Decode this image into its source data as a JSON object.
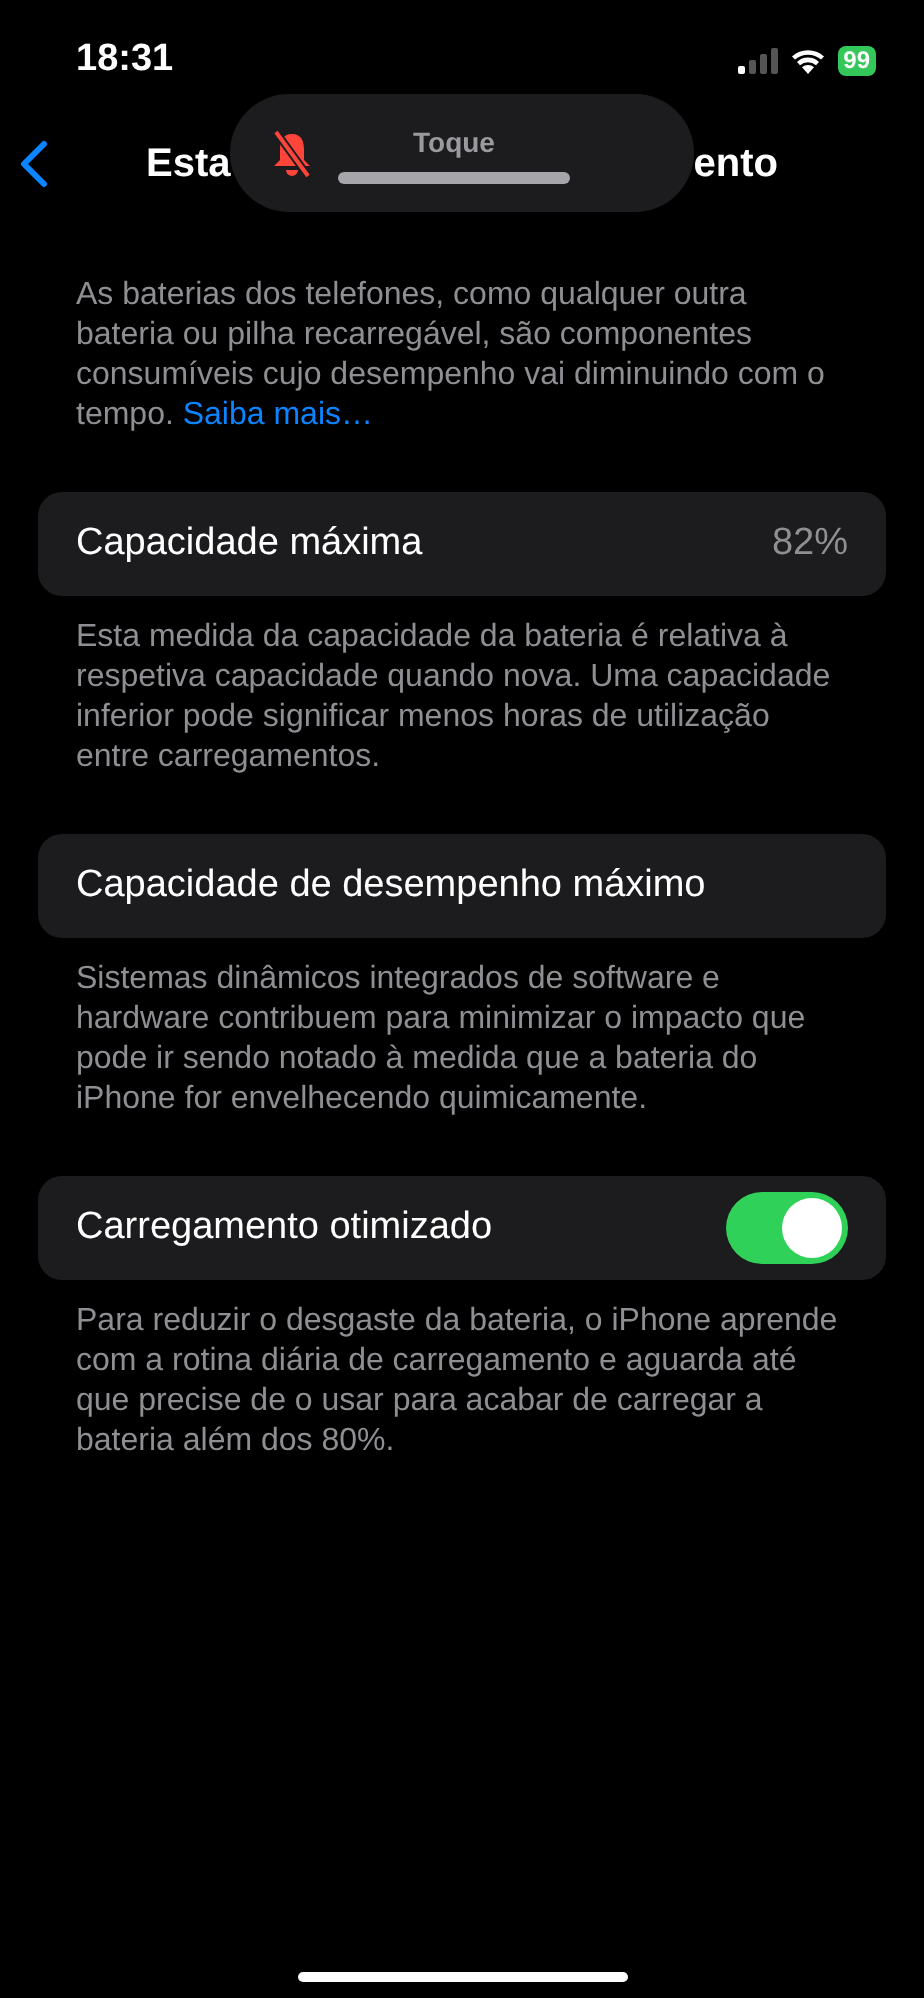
{
  "status_bar": {
    "time": "18:31",
    "battery": "99"
  },
  "nav": {
    "title_start": "Esta",
    "title_end": "ento"
  },
  "hud": {
    "label": "Toque",
    "muted": true,
    "level": 0
  },
  "intro": {
    "text": "As baterias dos telefones, como qualquer outra bateria ou pilha recarregável, são componentes consumíveis cujo desempenho vai diminuindo com o tempo.",
    "link": "Saiba mais…"
  },
  "sections": [
    {
      "kind": "value",
      "label": "Capacidade máxima",
      "value": "82%",
      "footer": "Esta medida da capacidade da bateria é relativa à respetiva capacidade quando nova. Uma capacidade inferior pode significar menos horas de utilização entre carregamentos."
    },
    {
      "kind": "plain",
      "label": "Capacidade de desempenho máximo",
      "footer": "Sistemas dinâmicos integrados de software e hardware contribuem para minimizar o impacto que pode ir sendo notado à medida que a bateria do iPhone for envelhecendo quimicamente."
    },
    {
      "kind": "toggle",
      "label": "Carregamento otimizado",
      "on": true,
      "footer": "Para reduzir o desgaste da bateria, o iPhone aprende com a rotina diária de carregamento e aguarda até que precise de o usar para acabar de carregar a bateria além dos 80%."
    }
  ]
}
